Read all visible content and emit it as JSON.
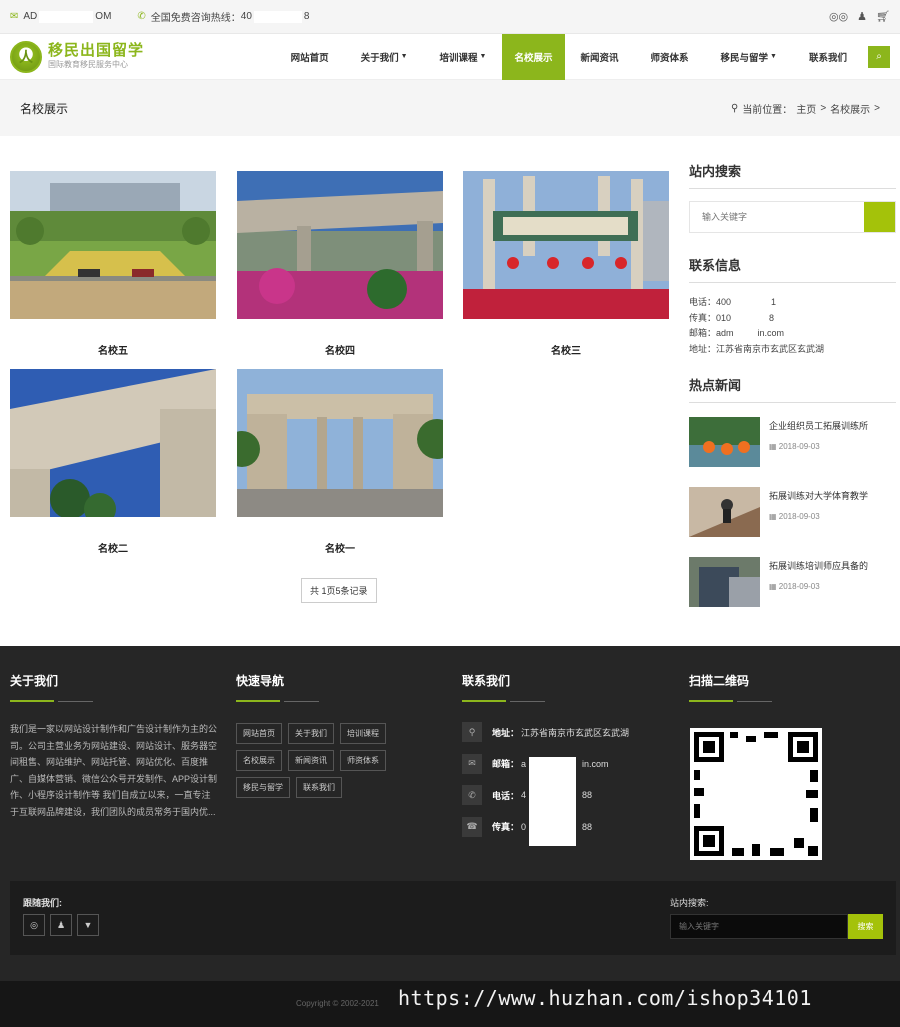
{
  "topbar": {
    "email_prefix": "AD",
    "email_suffix": "OM",
    "hotline_label": "全国免费咨询热线：",
    "hotline_prefix": "40",
    "hotline_suffix": "8"
  },
  "logo": {
    "main": "移民出国留学",
    "sub": "国际教育移民服务中心"
  },
  "nav": [
    {
      "label": "网站首页",
      "caret": false,
      "active": false
    },
    {
      "label": "关于我们",
      "caret": true,
      "active": false
    },
    {
      "label": "培训课程",
      "caret": true,
      "active": false
    },
    {
      "label": "名校展示",
      "caret": false,
      "active": true
    },
    {
      "label": "新闻资讯",
      "caret": false,
      "active": false
    },
    {
      "label": "师资体系",
      "caret": false,
      "active": false
    },
    {
      "label": "移民与留学",
      "caret": true,
      "active": false
    },
    {
      "label": "联系我们",
      "caret": false,
      "active": false
    }
  ],
  "titlebar": {
    "title": "名校展示",
    "location_label": "当前位置：",
    "crumb_home": "主页",
    "crumb_current": "名校展示",
    "sep": ">"
  },
  "schools": [
    {
      "name": "名校五"
    },
    {
      "name": "名校四"
    },
    {
      "name": "名校三"
    },
    {
      "name": "名校二"
    },
    {
      "name": "名校一"
    }
  ],
  "pager": "共 1页5条记录",
  "sidebar": {
    "search_title": "站内搜索",
    "search_placeholder": "输入关键字",
    "contact_title": "联系信息",
    "contact_lines": [
      "电话：400",
      "传真：010",
      "邮箱：adm",
      "地址：江苏省南京市玄武区玄武湖"
    ],
    "contact_tails": [
      "1",
      "8",
      "in.com",
      ""
    ],
    "news_title": "热点新闻",
    "news": [
      {
        "title": "企业组织员工拓展训练所",
        "date": "2018-09-03"
      },
      {
        "title": "拓展训练对大学体育教学",
        "date": "2018-09-03"
      },
      {
        "title": "拓展训练培训师应具备的",
        "date": "2018-09-03"
      }
    ]
  },
  "footer": {
    "about_title": "关于我们",
    "about_text": "我们是一家以网站设计制作和广告设计制作为主的公司。公司主营业务为网站建设、网站设计、服务器空间租售、网站维护、网站托管、网站优化、百度推广、自媒体营销、微信公众号开发制作、APP设计制作、小程序设计制作等 我们自成立以来，一直专注于互联网品牌建设，我们团队的成员常务于国内优...",
    "quicknav_title": "快速导航",
    "quicknav": [
      "网站首页",
      "关于我们",
      "培训课程",
      "名校展示",
      "新闻资讯",
      "师资体系",
      "移民与留学",
      "联系我们"
    ],
    "contact_title": "联系我们",
    "contact": [
      {
        "label": "地址：",
        "value": "江苏省南京市玄武区玄武湖"
      },
      {
        "label": "邮箱：",
        "value": "a",
        "tail": "in.com"
      },
      {
        "label": "电话：",
        "value": "4",
        "tail": "88"
      },
      {
        "label": "传真：",
        "value": "0",
        "tail": "88"
      }
    ],
    "qr_title": "扫描二维码",
    "follow_label": "跟随我们:",
    "search_label": "站内搜索:",
    "search_placeholder": "输入关键字",
    "search_button": "搜索",
    "copyright": "Copyright © 2002-2021",
    "watermark": "https://www.huzhan.com/ishop34101"
  },
  "colors": {
    "accent": "#8cb61c",
    "footer_bg": "#262626"
  }
}
